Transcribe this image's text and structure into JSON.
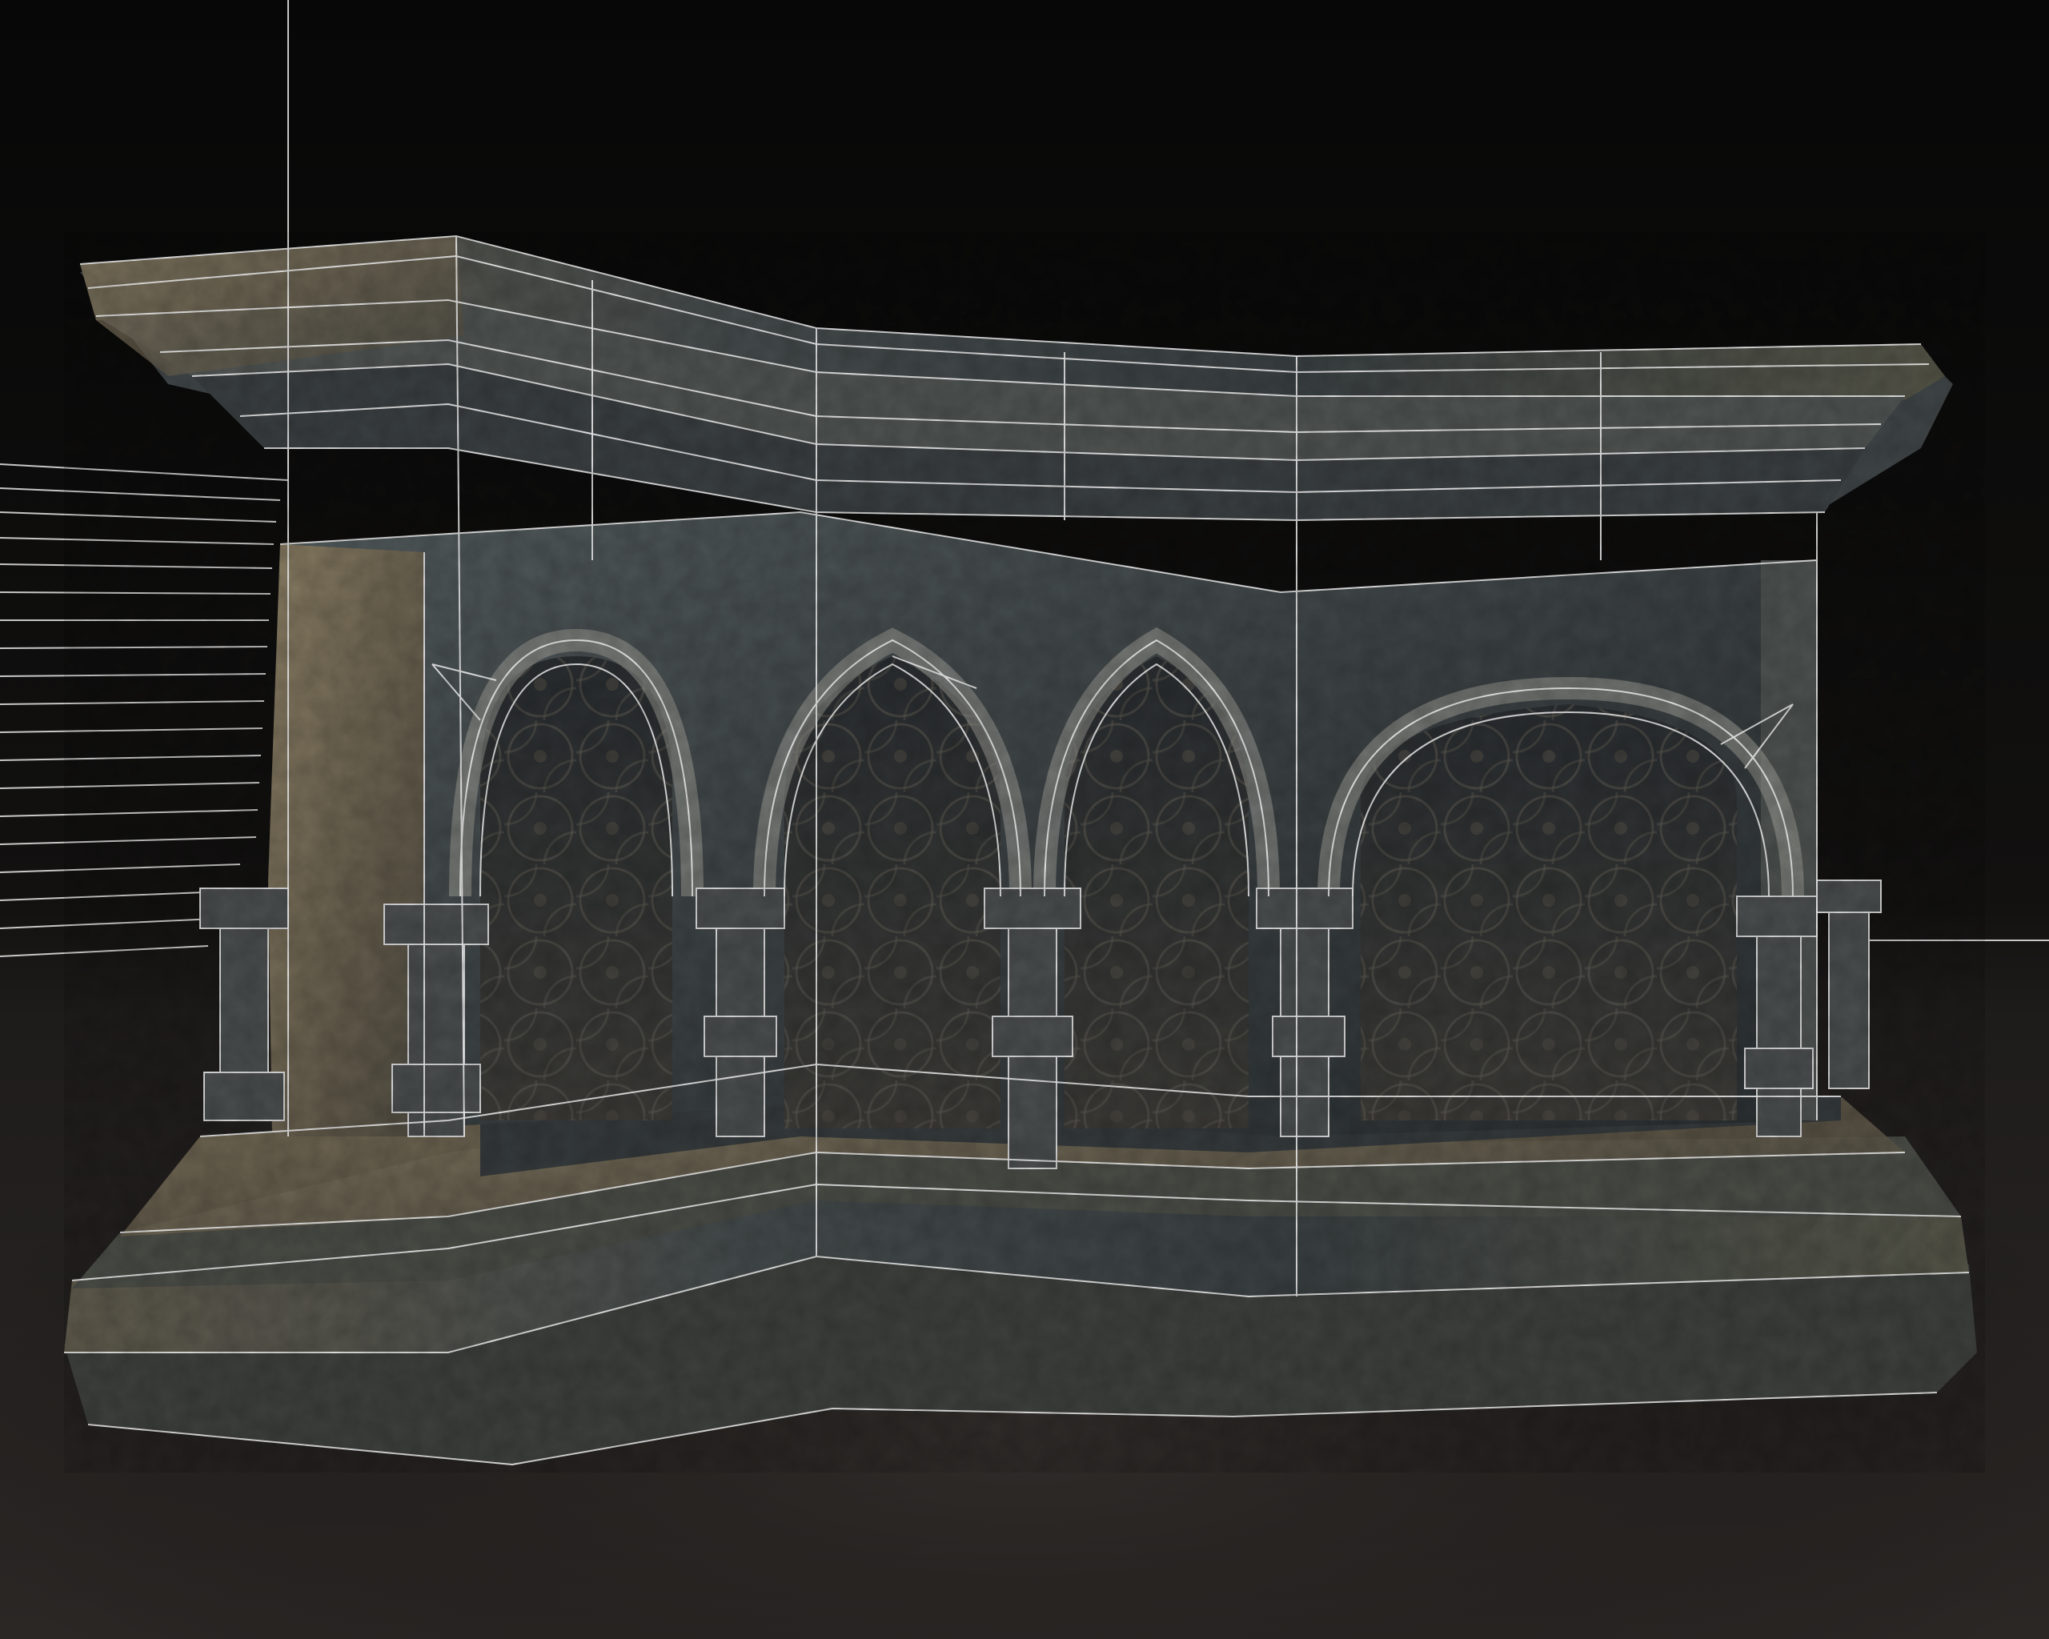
{
  "scene": {
    "subject": "gothic-stone-altar-wireframe-render",
    "colors": {
      "background_top": "#080808",
      "background_mid": "#151312",
      "floor_far": "#242120",
      "floor_near": "#2c2826",
      "stone_warm": "#6e6450",
      "stone_warm_light": "#8a7e64",
      "stone_cool": "#4a5052",
      "stone_cool_dark": "#2e3335",
      "stone_dark": "#23272a",
      "wire": "#f2f2f2"
    },
    "arches": [
      {
        "style": "round"
      },
      {
        "style": "pointed"
      },
      {
        "style": "pointed"
      },
      {
        "style": "round"
      }
    ]
  }
}
